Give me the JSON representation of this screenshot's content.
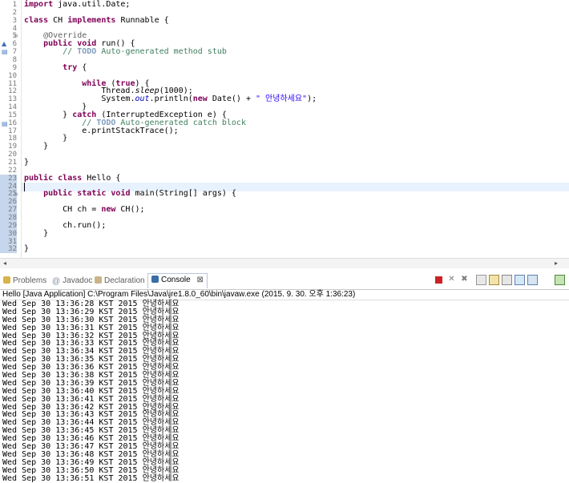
{
  "editor": {
    "lines": [
      {
        "n": "1",
        "tokens": [
          {
            "t": "import",
            "c": "kw"
          },
          {
            "t": " java.util.Date;"
          }
        ]
      },
      {
        "n": "2",
        "tokens": []
      },
      {
        "n": "3",
        "tokens": [
          {
            "t": "class",
            "c": "kw"
          },
          {
            "t": " CH "
          },
          {
            "t": "implements",
            "c": "kw"
          },
          {
            "t": " Runnable {"
          }
        ]
      },
      {
        "n": "4",
        "tokens": []
      },
      {
        "n": "5",
        "tokens": [
          {
            "t": "    "
          },
          {
            "t": "@Override",
            "c": "an"
          }
        ]
      },
      {
        "n": "6",
        "tokens": [
          {
            "t": "    "
          },
          {
            "t": "public",
            "c": "kw"
          },
          {
            "t": " "
          },
          {
            "t": "void",
            "c": "kw"
          },
          {
            "t": " run() {"
          }
        ]
      },
      {
        "n": "7",
        "tokens": [
          {
            "t": "        "
          },
          {
            "t": "// ",
            "c": "cm"
          },
          {
            "t": "TODO",
            "c": "cmt"
          },
          {
            "t": " Auto-generated method stub",
            "c": "cm"
          }
        ]
      },
      {
        "n": "8",
        "tokens": []
      },
      {
        "n": "9",
        "tokens": [
          {
            "t": "        "
          },
          {
            "t": "try",
            "c": "kw"
          },
          {
            "t": " {"
          }
        ]
      },
      {
        "n": "10",
        "tokens": []
      },
      {
        "n": "11",
        "tokens": [
          {
            "t": "            "
          },
          {
            "t": "while",
            "c": "kw"
          },
          {
            "t": " ("
          },
          {
            "t": "true",
            "c": "kw"
          },
          {
            "t": ") {"
          }
        ]
      },
      {
        "n": "12",
        "tokens": [
          {
            "t": "                Thread."
          },
          {
            "t": "sleep",
            "c": "it"
          },
          {
            "t": "(1000);"
          }
        ]
      },
      {
        "n": "13",
        "tokens": [
          {
            "t": "                System."
          },
          {
            "t": "out",
            "c": "fi"
          },
          {
            "t": ".println("
          },
          {
            "t": "new",
            "c": "kw"
          },
          {
            "t": " Date() + "
          },
          {
            "t": "\" 안녕하세요\"",
            "c": "st"
          },
          {
            "t": ");"
          }
        ]
      },
      {
        "n": "14",
        "tokens": [
          {
            "t": "            }"
          }
        ]
      },
      {
        "n": "15",
        "tokens": [
          {
            "t": "        } "
          },
          {
            "t": "catch",
            "c": "kw"
          },
          {
            "t": " (InterruptedException e) {"
          }
        ]
      },
      {
        "n": "16",
        "tokens": [
          {
            "t": "            "
          },
          {
            "t": "// ",
            "c": "cm"
          },
          {
            "t": "TODO",
            "c": "cmt"
          },
          {
            "t": " Auto-generated catch block",
            "c": "cm"
          }
        ]
      },
      {
        "n": "17",
        "tokens": [
          {
            "t": "            e.printStackTrace();"
          }
        ]
      },
      {
        "n": "18",
        "tokens": [
          {
            "t": "        }"
          }
        ]
      },
      {
        "n": "19",
        "tokens": [
          {
            "t": "    }"
          }
        ]
      },
      {
        "n": "20",
        "tokens": []
      },
      {
        "n": "21",
        "tokens": [
          {
            "t": "}"
          }
        ]
      },
      {
        "n": "22",
        "tokens": []
      },
      {
        "n": "23",
        "tokens": [
          {
            "t": "public",
            "c": "kw"
          },
          {
            "t": " "
          },
          {
            "t": "class",
            "c": "kw"
          },
          {
            "t": " Hello {"
          }
        ]
      },
      {
        "n": "24",
        "tokens": []
      },
      {
        "n": "25",
        "tokens": [
          {
            "t": "    "
          },
          {
            "t": "public",
            "c": "kw"
          },
          {
            "t": " "
          },
          {
            "t": "static",
            "c": "kw"
          },
          {
            "t": " "
          },
          {
            "t": "void",
            "c": "kw"
          },
          {
            "t": " main(String[] args) {"
          }
        ]
      },
      {
        "n": "26",
        "tokens": []
      },
      {
        "n": "27",
        "tokens": [
          {
            "t": "        CH ch = "
          },
          {
            "t": "new",
            "c": "kw"
          },
          {
            "t": " CH();"
          }
        ]
      },
      {
        "n": "28",
        "tokens": []
      },
      {
        "n": "29",
        "tokens": [
          {
            "t": "        ch.run();"
          }
        ]
      },
      {
        "n": "30",
        "tokens": [
          {
            "t": "    }"
          }
        ]
      },
      {
        "n": "31",
        "tokens": []
      },
      {
        "n": "32",
        "tokens": [
          {
            "t": "}"
          }
        ]
      }
    ]
  },
  "console_view": {
    "tabs": [
      {
        "label": "Problems",
        "icon": "problems-icon",
        "active": false
      },
      {
        "label": "Javadoc",
        "icon": "javadoc-icon",
        "active": false
      },
      {
        "label": "Declaration",
        "icon": "declaration-icon",
        "active": false
      },
      {
        "label": "Console",
        "icon": "console-icon",
        "active": true
      }
    ],
    "close_glyph": "⊠",
    "process_line": "Hello [Java Application] C:\\Program Files\\Java\\jre1.8.0_60\\bin\\javaw.exe (2015. 9. 30. 오후 1:36:23)",
    "output": [
      "Wed Sep 30 13:36:28 KST 2015 안녕하세요",
      "Wed Sep 30 13:36:29 KST 2015 안녕하세요",
      "Wed Sep 30 13:36:30 KST 2015 안녕하세요",
      "Wed Sep 30 13:36:31 KST 2015 안녕하세요",
      "Wed Sep 30 13:36:32 KST 2015 안녕하세요",
      "Wed Sep 30 13:36:33 KST 2015 안녕하세요",
      "Wed Sep 30 13:36:34 KST 2015 안녕하세요",
      "Wed Sep 30 13:36:35 KST 2015 안녕하세요",
      "Wed Sep 30 13:36:36 KST 2015 안녕하세요",
      "Wed Sep 30 13:36:38 KST 2015 안녕하세요",
      "Wed Sep 30 13:36:39 KST 2015 안녕하세요",
      "Wed Sep 30 13:36:40 KST 2015 안녕하세요",
      "Wed Sep 30 13:36:41 KST 2015 안녕하세요",
      "Wed Sep 30 13:36:42 KST 2015 안녕하세요",
      "Wed Sep 30 13:36:43 KST 2015 안녕하세요",
      "Wed Sep 30 13:36:44 KST 2015 안녕하세요",
      "Wed Sep 30 13:36:45 KST 2015 안녕하세요",
      "Wed Sep 30 13:36:46 KST 2015 안녕하세요",
      "Wed Sep 30 13:36:47 KST 2015 안녕하세요",
      "Wed Sep 30 13:36:48 KST 2015 안녕하세요",
      "Wed Sep 30 13:36:49 KST 2015 안녕하세요",
      "Wed Sep 30 13:36:50 KST 2015 안녕하세요",
      "Wed Sep 30 13:36:51 KST 2015 안녕하세요"
    ],
    "toolbar_icons": [
      "terminate-icon",
      "remove-launch-icon",
      "remove-all-icon",
      "clear-console-icon",
      "scroll-lock-icon",
      "word-wrap-icon",
      "pin-console-icon",
      "display-selected-icon",
      "open-console-icon"
    ]
  },
  "colors": {
    "keyword": "#7f0055",
    "comment": "#3f7f5f",
    "string": "#2a00ff",
    "field": "#0000c0",
    "annotation": "#646464",
    "terminate": "#cc2222"
  }
}
